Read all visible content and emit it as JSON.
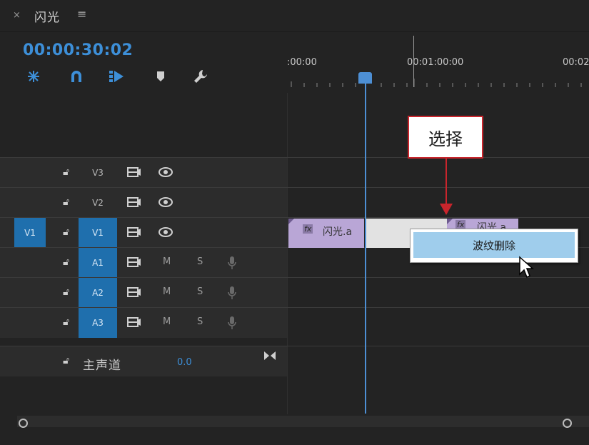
{
  "tab": {
    "close": "×",
    "title": "闪光",
    "menu": "≡"
  },
  "timecode": "00:00:30:02",
  "tools": [
    "snap-insert-icon",
    "magnet-icon",
    "linked-selection-icon",
    "add-marker-icon",
    "wrench-icon"
  ],
  "ruler": {
    "labels": [
      ":00:00",
      "00:01:00:00",
      "00:02"
    ]
  },
  "tracks": {
    "video": [
      {
        "name": "V3"
      },
      {
        "name": "V2"
      },
      {
        "name": "V1",
        "source": "V1"
      }
    ],
    "audio": [
      {
        "name": "A1",
        "m": "M",
        "s": "S"
      },
      {
        "name": "A2",
        "m": "M",
        "s": "S"
      },
      {
        "name": "A3",
        "m": "M",
        "s": "S"
      }
    ],
    "master": {
      "label": "主声道",
      "value": "0.0"
    }
  },
  "clips": [
    {
      "fx": "fx",
      "name": "闪光.a"
    },
    {
      "fx": "fx",
      "name": "闪光.a"
    }
  ],
  "context_menu": {
    "item": "波纹删除"
  },
  "callout": "选择",
  "colors": {
    "accent": "#1f6fad",
    "timecode": "#3d8fd8",
    "clip": "#b9a6d6",
    "menu_highlight": "#9fcdec",
    "annotation": "#c9252c"
  }
}
